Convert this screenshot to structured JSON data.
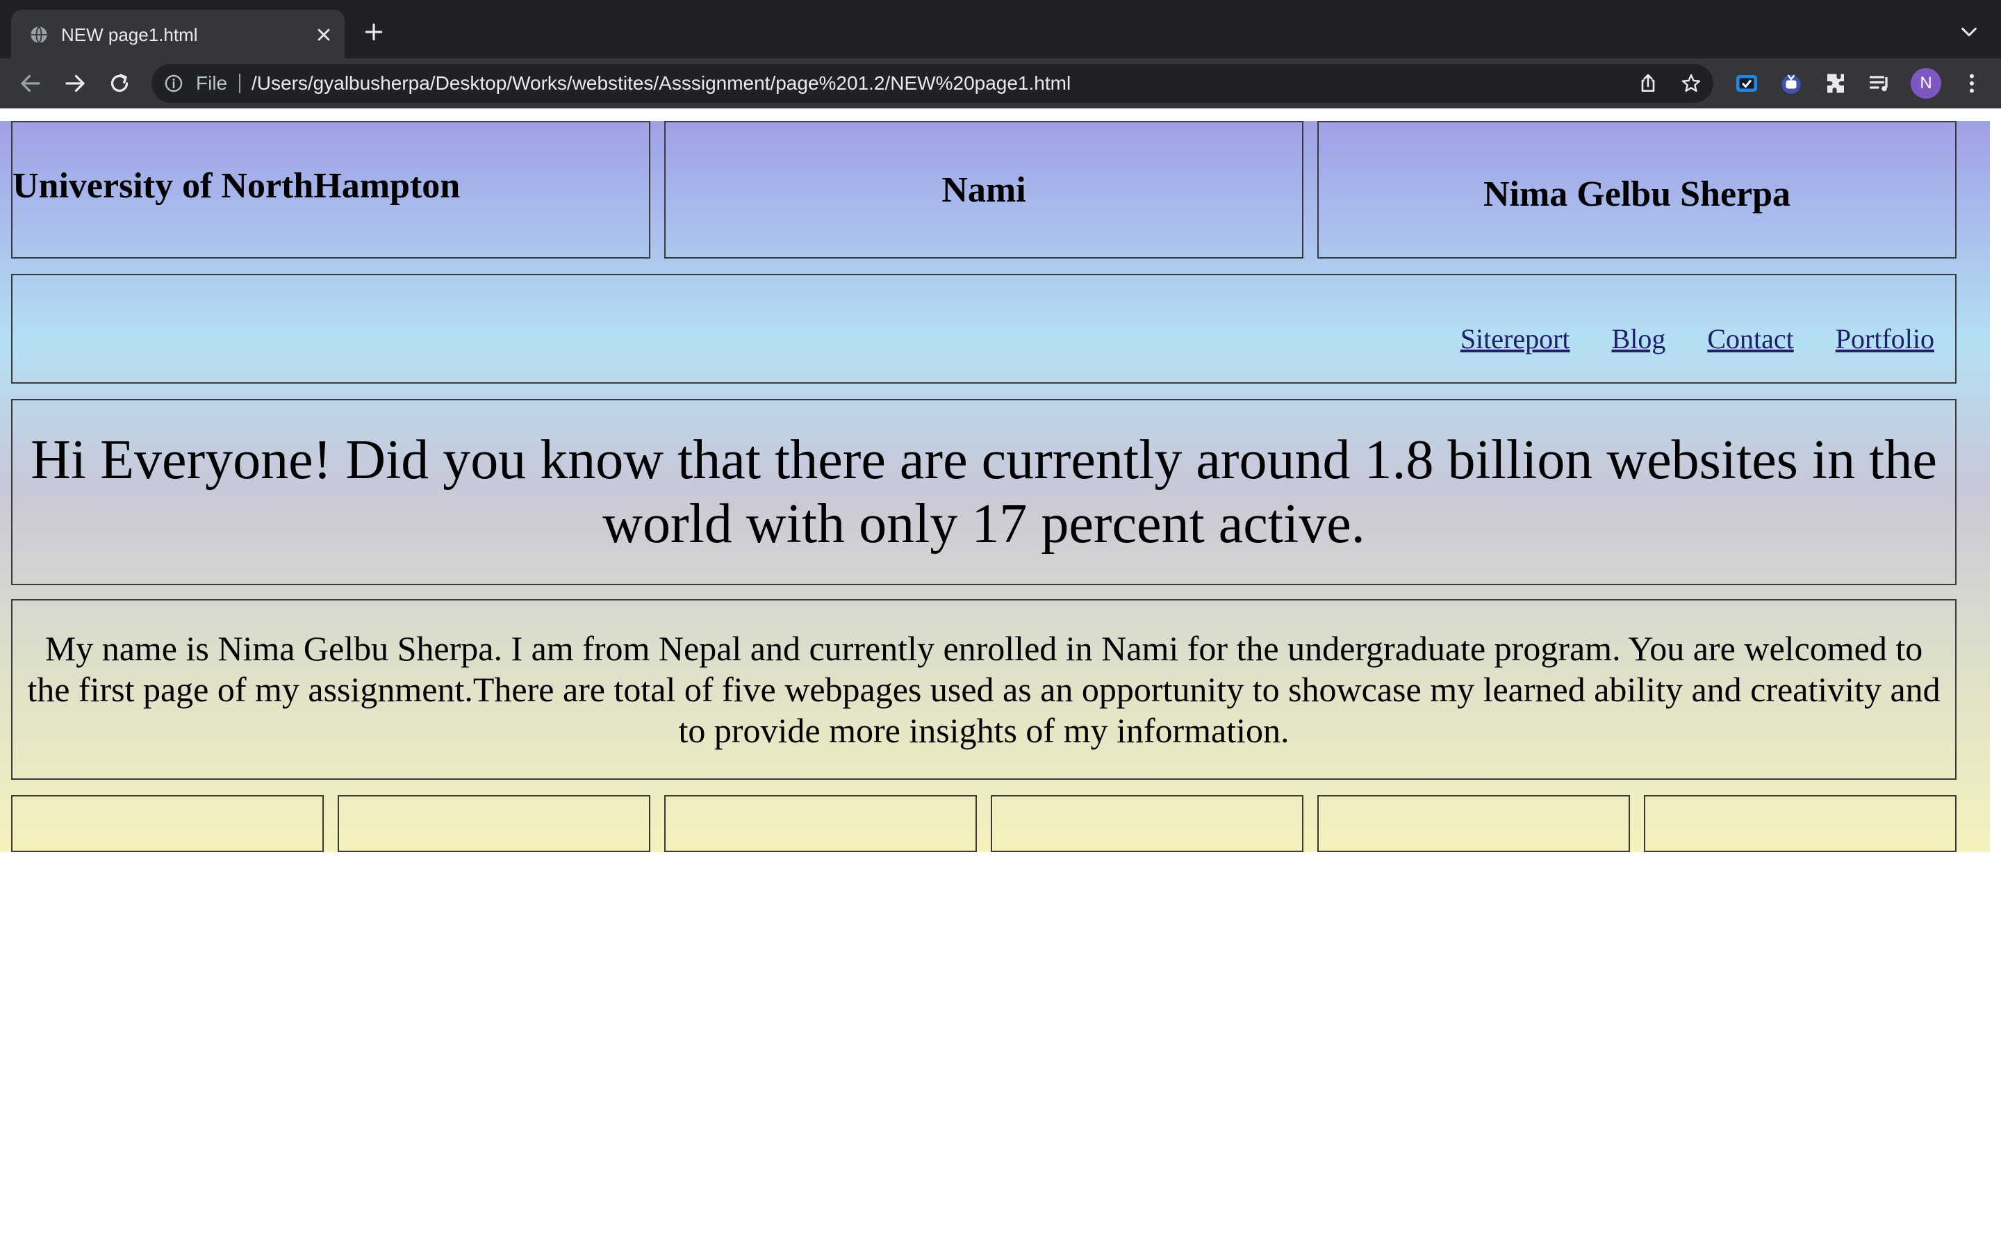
{
  "browser": {
    "tab_title": "NEW page1.html",
    "omnibox_scheme": "File",
    "url": "/Users/gyalbusherpa/Desktop/Works/webstites/Asssignment/page%201.2/NEW%20page1.html",
    "profile_initial": "N"
  },
  "header": {
    "col1": "University of NorthHampton",
    "col2": "Nami",
    "col3": "Nima Gelbu Sherpa"
  },
  "nav": {
    "links": [
      "Sitereport",
      "Blog",
      "Contact",
      "Portfolio"
    ]
  },
  "hero": {
    "text": "Hi Everyone! Did you know that there are currently around 1.8 billion websites in the world with only 17 percent active."
  },
  "intro": {
    "text": "My name is Nima Gelbu Sherpa. I am from Nepal and currently enrolled in Nami for the undergraduate program. You are welcomed to the first page of my assignment.There are total of five webpages used as an opportunity to showcase my learned ability and creativity and to provide more insights of my information."
  },
  "colors": {
    "chrome_dark": "#202124",
    "chrome_toolbar": "#35363a",
    "gradient_top": "#a0a0e6",
    "gradient_nav": "#b4e0f4",
    "gradient_bottom": "#f6f2bc",
    "link": "#20206a"
  }
}
